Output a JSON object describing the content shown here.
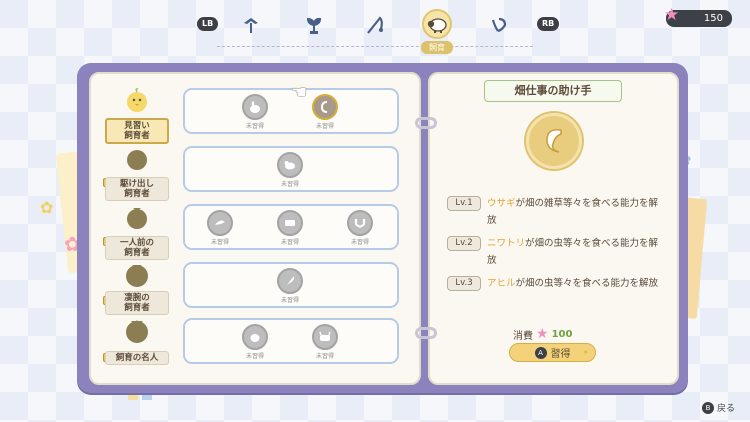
{
  "top": {
    "lb": "LB",
    "rb": "RB",
    "active_category": "飼育",
    "stars": "150",
    "categories": [
      "tool-icon",
      "sprout-icon",
      "fishing-rod-icon",
      "sheep-icon",
      "mushroom-icon"
    ]
  },
  "ranks": [
    {
      "label": "見習い\n飼育者",
      "locked": false,
      "selected": true
    },
    {
      "label": "駆け出し\n飼育者",
      "locked": true,
      "selected": false
    },
    {
      "label": "一人前の\n飼育者",
      "locked": true,
      "selected": false
    },
    {
      "label": "凄腕の\n飼育者",
      "locked": true,
      "selected": false
    },
    {
      "label": "飼育の名人",
      "locked": true,
      "selected": false
    }
  ],
  "skill_caption": "未習得",
  "detail": {
    "title": "畑仕事の助け手",
    "levels": [
      {
        "badge": "Lv.1",
        "highlight": "ウサギ",
        "text": "が畑の雑草等々を食べる能力を解放"
      },
      {
        "badge": "Lv.2",
        "highlight": "ニワトリ",
        "text": "が畑の虫等々を食べる能力を解放"
      },
      {
        "badge": "Lv.3",
        "highlight": "アヒル",
        "text": "が畑の虫等々を食べる能力を解放"
      }
    ],
    "cost_label": "消費",
    "cost_value": "100",
    "learn_button": "習得",
    "a_key": "A"
  },
  "footer": {
    "b_key": "B",
    "back_label": "戻る"
  },
  "colors": {
    "book": "#8b82be",
    "accent": "#e0a53a",
    "cost": "#6fa342"
  }
}
